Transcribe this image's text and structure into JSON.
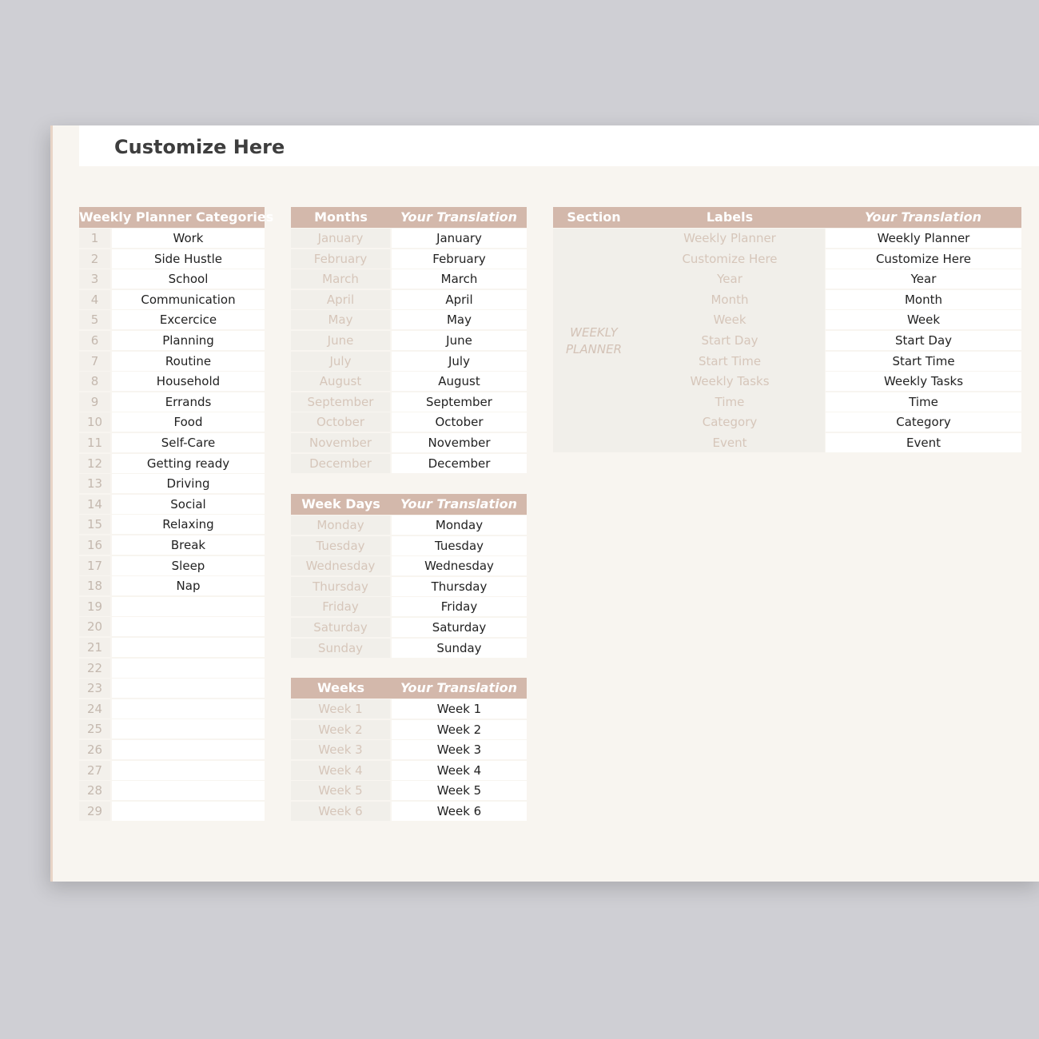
{
  "page": {
    "title": "Customize Here"
  },
  "categories": {
    "header": "Weekly Planner Categories",
    "rows": [
      {
        "n": "1",
        "v": "Work"
      },
      {
        "n": "2",
        "v": "Side Hustle"
      },
      {
        "n": "3",
        "v": "School"
      },
      {
        "n": "4",
        "v": "Communication"
      },
      {
        "n": "5",
        "v": "Excercice"
      },
      {
        "n": "6",
        "v": "Planning"
      },
      {
        "n": "7",
        "v": "Routine"
      },
      {
        "n": "8",
        "v": "Household"
      },
      {
        "n": "9",
        "v": "Errands"
      },
      {
        "n": "10",
        "v": "Food"
      },
      {
        "n": "11",
        "v": "Self-Care"
      },
      {
        "n": "12",
        "v": "Getting ready"
      },
      {
        "n": "13",
        "v": "Driving"
      },
      {
        "n": "14",
        "v": "Social"
      },
      {
        "n": "15",
        "v": "Relaxing"
      },
      {
        "n": "16",
        "v": "Break"
      },
      {
        "n": "17",
        "v": "Sleep"
      },
      {
        "n": "18",
        "v": "Nap"
      },
      {
        "n": "19",
        "v": ""
      },
      {
        "n": "20",
        "v": ""
      },
      {
        "n": "21",
        "v": ""
      },
      {
        "n": "22",
        "v": ""
      },
      {
        "n": "23",
        "v": ""
      },
      {
        "n": "24",
        "v": ""
      },
      {
        "n": "25",
        "v": ""
      },
      {
        "n": "26",
        "v": ""
      },
      {
        "n": "27",
        "v": ""
      },
      {
        "n": "28",
        "v": ""
      },
      {
        "n": "29",
        "v": ""
      }
    ]
  },
  "months": {
    "header": "Months",
    "translation_header": "Your Translation",
    "rows": [
      {
        "s": "January",
        "v": "January"
      },
      {
        "s": "February",
        "v": "February"
      },
      {
        "s": "March",
        "v": "March"
      },
      {
        "s": "April",
        "v": "April"
      },
      {
        "s": "May",
        "v": "May"
      },
      {
        "s": "June",
        "v": "June"
      },
      {
        "s": "July",
        "v": "July"
      },
      {
        "s": "August",
        "v": "August"
      },
      {
        "s": "September",
        "v": "September"
      },
      {
        "s": "October",
        "v": "October"
      },
      {
        "s": "November",
        "v": "November"
      },
      {
        "s": "December",
        "v": "December"
      }
    ]
  },
  "weekdays": {
    "header": "Week Days",
    "translation_header": "Your Translation",
    "rows": [
      {
        "s": "Monday",
        "v": "Monday"
      },
      {
        "s": "Tuesday",
        "v": "Tuesday"
      },
      {
        "s": "Wednesday",
        "v": "Wednesday"
      },
      {
        "s": "Thursday",
        "v": "Thursday"
      },
      {
        "s": "Friday",
        "v": "Friday"
      },
      {
        "s": "Saturday",
        "v": "Saturday"
      },
      {
        "s": "Sunday",
        "v": "Sunday"
      }
    ]
  },
  "weeks": {
    "header": "Weeks",
    "translation_header": "Your Translation",
    "rows": [
      {
        "s": "Week 1",
        "v": "Week 1"
      },
      {
        "s": "Week 2",
        "v": "Week 2"
      },
      {
        "s": "Week 3",
        "v": "Week 3"
      },
      {
        "s": "Week 4",
        "v": "Week 4"
      },
      {
        "s": "Week 5",
        "v": "Week 5"
      },
      {
        "s": "Week 6",
        "v": "Week 6"
      }
    ]
  },
  "labels": {
    "section_header": "Section",
    "labels_header": "Labels",
    "translation_header": "Your Translation",
    "section_name_line1": "WEEKLY",
    "section_name_line2": "PLANNER",
    "rows": [
      {
        "s": "Weekly Planner",
        "v": "Weekly Planner"
      },
      {
        "s": "Customize Here",
        "v": "Customize Here"
      },
      {
        "s": "Year",
        "v": "Year"
      },
      {
        "s": "Month",
        "v": "Month"
      },
      {
        "s": "Week",
        "v": "Week"
      },
      {
        "s": "Start Day",
        "v": "Start Day"
      },
      {
        "s": "Start Time",
        "v": "Start Time"
      },
      {
        "s": "Weekly Tasks",
        "v": "Weekly Tasks"
      },
      {
        "s": "Time",
        "v": "Time"
      },
      {
        "s": "Category",
        "v": "Category"
      },
      {
        "s": "Event",
        "v": "Event"
      }
    ]
  }
}
